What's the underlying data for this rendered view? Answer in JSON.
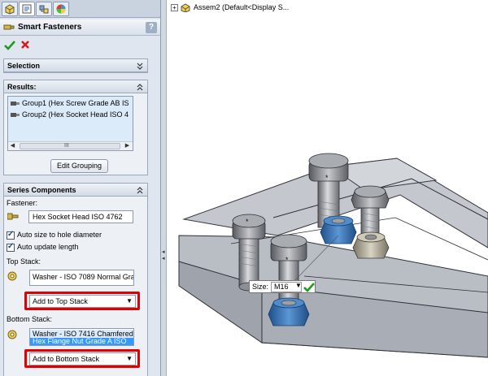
{
  "panel": {
    "title": "Smart Fasteners",
    "help": "?",
    "tabs": [
      "feature-manager-tab",
      "property-manager-tab",
      "configuration-manager-tab",
      "appearance-tab"
    ]
  },
  "selection": {
    "header": "Selection"
  },
  "results": {
    "header": "Results:",
    "items": [
      "Group1 (Hex Screw Grade AB IS",
      "Group2 (Hex Socket Head ISO 4"
    ],
    "scroll_grip": "III",
    "edit_grouping": "Edit Grouping"
  },
  "series": {
    "header": "Series Components",
    "fastener_label": "Fastener:",
    "fastener_value": "Hex Socket Head ISO 4762",
    "auto_size": "Auto size to hole diameter",
    "auto_update": "Auto update length",
    "top_stack_label": "Top Stack:",
    "top_stack_items": [
      "Washer - ISO 7089 Normal Gra"
    ],
    "add_top": "Add to Top Stack",
    "bottom_stack_label": "Bottom Stack:",
    "bottom_stack_items": [
      "Washer - ISO 7416 Chamfered",
      "Hex Flange Nut Grade A ISO"
    ],
    "add_bottom": "Add to Bottom Stack"
  },
  "viewport": {
    "tree_label": "Assem2  (Default<Display S...",
    "size_label": "Size:",
    "size_value": "M16"
  },
  "colors": {
    "highlight_frame": "#e00000",
    "selected_row": "#3399ff",
    "nut_blue": "#2f6fb3"
  }
}
